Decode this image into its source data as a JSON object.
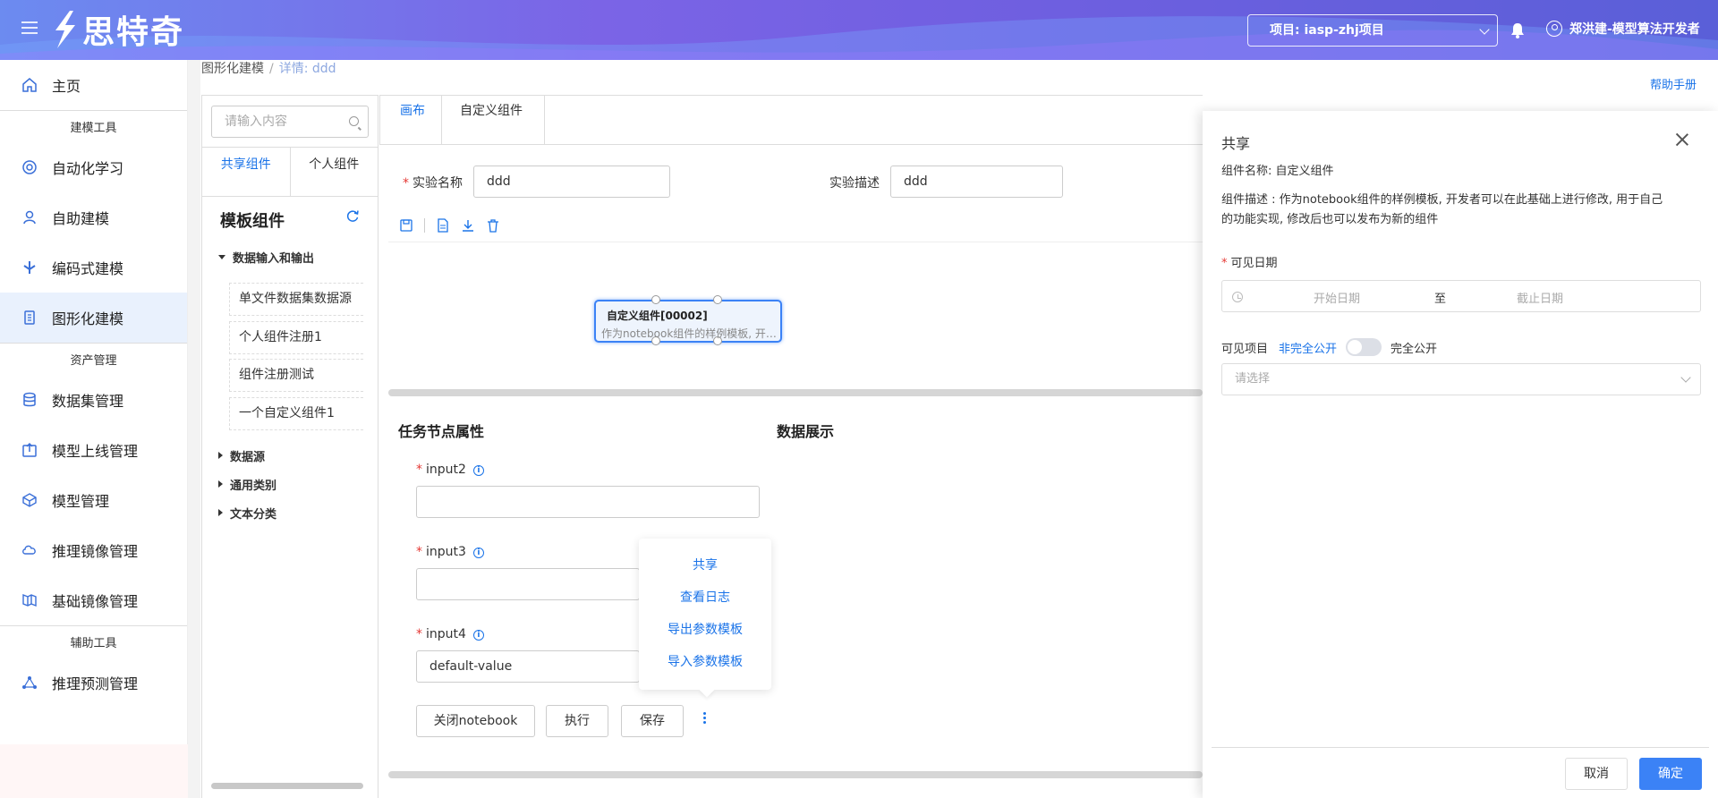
{
  "header": {
    "logo_text": "思特奇",
    "project": "项目: iasp-zhj项目",
    "user": "郑洪建-模型算法开发者"
  },
  "sidebar": {
    "items": [
      {
        "label": "主页",
        "icon": "home-icon"
      },
      {
        "group": "建模工具"
      },
      {
        "label": "自动化学习",
        "icon": "auto-learn-icon"
      },
      {
        "label": "自助建模",
        "icon": "self-model-icon"
      },
      {
        "label": "编码式建模",
        "icon": "code-model-icon"
      },
      {
        "label": "图形化建模",
        "icon": "graph-model-icon",
        "active": true
      },
      {
        "group": "资产管理"
      },
      {
        "label": "数据集管理",
        "icon": "dataset-icon"
      },
      {
        "label": "模型上线管理",
        "icon": "deploy-icon"
      },
      {
        "label": "模型管理",
        "icon": "model-icon"
      },
      {
        "label": "推理镜像管理",
        "icon": "infer-image-icon"
      },
      {
        "label": "基础镜像管理",
        "icon": "base-image-icon"
      },
      {
        "group": "辅助工具"
      },
      {
        "label": "推理预测管理",
        "icon": "predict-icon"
      }
    ]
  },
  "breadcrumb": {
    "parent": "图形化建模",
    "sep": "/",
    "current": "详情: ddd"
  },
  "help_link": "帮助手册",
  "components": {
    "search_placeholder": "请输入内容",
    "tabs": [
      "共享组件",
      "个人组件"
    ],
    "title": "模板组件",
    "tree": {
      "open_group": "数据输入和输出",
      "leaves": [
        "单文件数据集数据源",
        "个人组件注册1",
        "组件注册测试",
        "一个自定义组件1"
      ],
      "groups": [
        "数据源",
        "通用类别",
        "文本分类"
      ]
    }
  },
  "main": {
    "tabs": [
      "画布",
      "自定义组件"
    ],
    "exp_name_label": "实验名称",
    "exp_name_value": "ddd",
    "exp_desc_label": "实验描述",
    "exp_desc_value": "ddd",
    "node": {
      "title": "自定义组件[00002]",
      "desc": "作为notebook组件的样例模板, 开发者可以在此基础上进行修改"
    },
    "props_title": "任务节点属性",
    "data_title": "数据展示",
    "fields": [
      {
        "label": "input2",
        "value": ""
      },
      {
        "label": "input3",
        "value": ""
      },
      {
        "label": "input4",
        "value": "default-value"
      }
    ],
    "buttons": {
      "close_nb": "关闭notebook",
      "run": "执行",
      "save": "保存"
    },
    "popover": [
      "共享",
      "查看日志",
      "导出参数模板",
      "导入参数模板"
    ]
  },
  "drawer": {
    "title": "共享",
    "comp_name": "组件名称: 自定义组件",
    "comp_desc_line1": "组件描述 : 作为notebook组件的样例模板, 开发者可以在此基础上进行修改, 用于自己",
    "comp_desc_line2": "的功能实现, 修改后也可以发布为新的组件",
    "date_label": "可见日期",
    "start_placeholder": "开始日期",
    "to": "至",
    "end_placeholder": "截止日期",
    "proj_label": "可见项目",
    "opt_partial": "非完全公开",
    "opt_full": "完全公开",
    "select_placeholder": "请选择",
    "cancel": "取消",
    "ok": "确定"
  },
  "colors": {
    "accent": "#1a73e8",
    "primary_btn": "#3b82f6",
    "required": "#e53935"
  }
}
